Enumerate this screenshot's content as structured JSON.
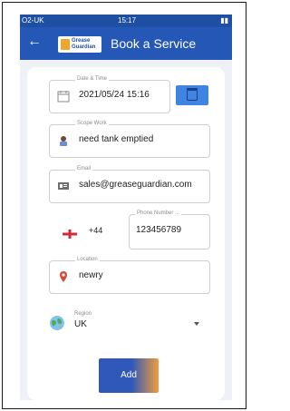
{
  "statusbar": {
    "carrier": "O2-UK",
    "time": "15:17"
  },
  "appbar": {
    "title": "Book a Service",
    "logo": {
      "line1": "Grease",
      "line2": "Guardian"
    }
  },
  "form": {
    "date_time": {
      "label": "Date & Time",
      "value": "2021/05/24 15:16"
    },
    "scope_work": {
      "label": "Scope Work",
      "value": "need tank emptied"
    },
    "email": {
      "label": "Email",
      "value": "sales@greaseguardian.com"
    },
    "phone": {
      "country_code": "+44",
      "label": "Phone Number ...",
      "value": "123456789"
    },
    "location": {
      "label": "Location",
      "value": "newry"
    },
    "region": {
      "label": "Region",
      "value": "UK"
    }
  },
  "actions": {
    "add_label": "Add"
  }
}
